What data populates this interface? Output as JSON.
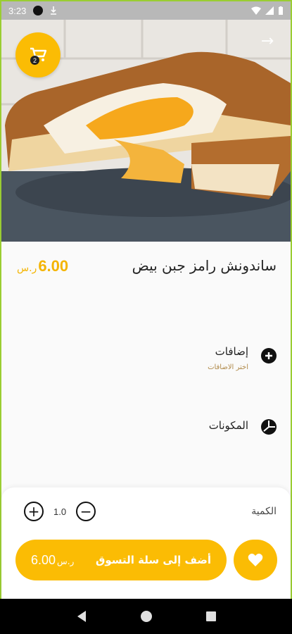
{
  "status_bar": {
    "time": "3:23"
  },
  "cart": {
    "badge_count": "2"
  },
  "product": {
    "title": "ساندونش رامز جبن بيض",
    "price": "6.00",
    "currency": "ر.س"
  },
  "options": [
    {
      "label": "إضافات",
      "sublabel": "اختر الاضافات",
      "icon": "plus-circle-icon"
    },
    {
      "label": "المكونات",
      "sublabel": "",
      "icon": "pie-chart-icon"
    }
  ],
  "quantity": {
    "label": "الكمية",
    "value": "1.0"
  },
  "add_to_cart": {
    "label": "أضف إلى سلة التسوق",
    "price": "6.00",
    "currency": "ر.س"
  },
  "colors": {
    "accent": "#fbbc04",
    "price": "#f4b400"
  }
}
